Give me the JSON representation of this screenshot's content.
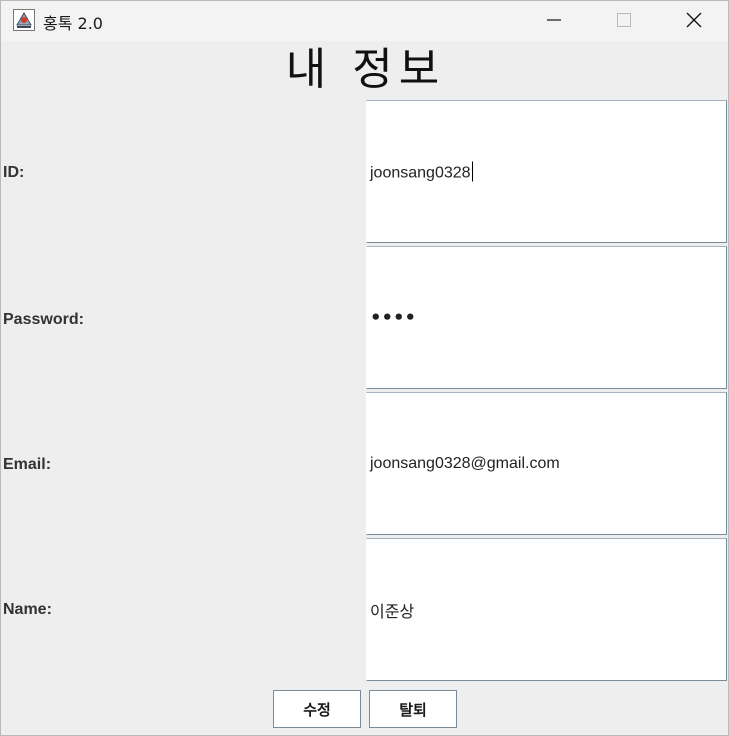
{
  "window": {
    "title": "홍톡 2.0"
  },
  "page": {
    "heading": "내 정보"
  },
  "fields": [
    {
      "label": "ID:",
      "value": "joonsang0328"
    },
    {
      "label": "Password:",
      "value": "••••"
    },
    {
      "label": "Email:",
      "value": "joonsang0328@gmail.com"
    },
    {
      "label": "Name:",
      "value": "이준상"
    }
  ],
  "buttons": {
    "edit_label": "수정",
    "withdraw_label": "탈퇴"
  },
  "icons": {
    "app": "java-cup-icon",
    "minimize": "minimize-icon",
    "maximize": "maximize-icon",
    "close": "close-icon"
  }
}
